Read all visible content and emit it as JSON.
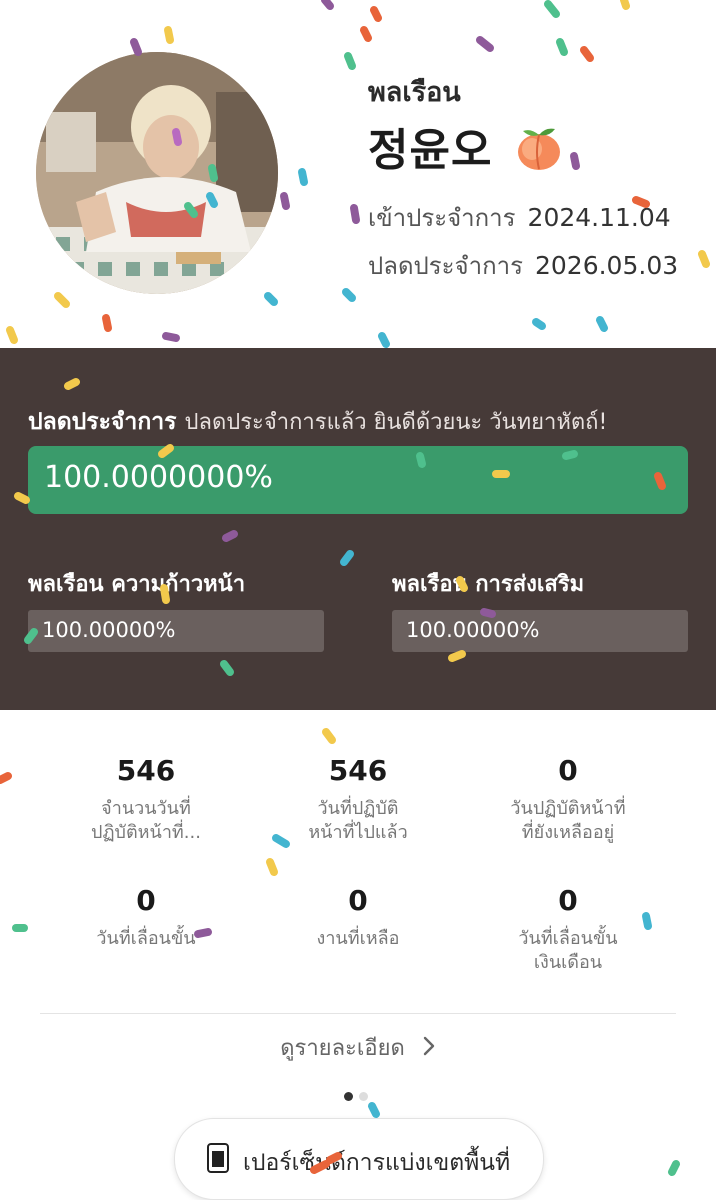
{
  "profile": {
    "rank": "พลเรือน",
    "name": "정윤오",
    "emoji_icon": "peach-icon",
    "enlist_label": "เข้าประจำการ",
    "enlist_date": "2024.11.04",
    "discharge_label": "ปลดประจำการ",
    "discharge_date": "2026.05.03"
  },
  "service": {
    "title": "ปลดประจำการ",
    "message": "ปลดประจำการแล้ว ยินดีด้วยนะ วันทยาหัตถ์!",
    "progress_text": "100.0000000%",
    "progress": 1.0,
    "color_bar": "#3a9b6b",
    "color_panel": "#463a38"
  },
  "sub_progress": [
    {
      "label": "พลเรือน ความก้าวหน้า",
      "value_text": "100.00000%",
      "progress": 1.0
    },
    {
      "label": "พลเรือน การส่งเสริม",
      "value_text": "100.00000%",
      "progress": 1.0
    }
  ],
  "stats": [
    {
      "value": "546",
      "label1": "จำนวนวันที่",
      "label2": "ปฏิบัติหน้าที่..."
    },
    {
      "value": "546",
      "label1": "วันที่ปฏิบัติ",
      "label2": "หน้าที่ไปแล้ว"
    },
    {
      "value": "0",
      "label1": "วันปฏิบัติหน้าที่",
      "label2": "ที่ยังเหลืออยู่"
    },
    {
      "value": "0",
      "label1": "วันที่เลื่อนขั้น",
      "label2": ""
    },
    {
      "value": "0",
      "label1": "งานที่เหลือ",
      "label2": ""
    },
    {
      "value": "0",
      "label1": "วันที่เลื่อนขั้น",
      "label2": "เงินเดือน"
    }
  ],
  "details_link": "ดูรายละเอียด",
  "pager": {
    "pages": 2,
    "current": 1
  },
  "bottom_button": {
    "label": "เปอร์เซ็นต์การแบ่งเขตพื้นที่",
    "icon": "phone-icon"
  }
}
